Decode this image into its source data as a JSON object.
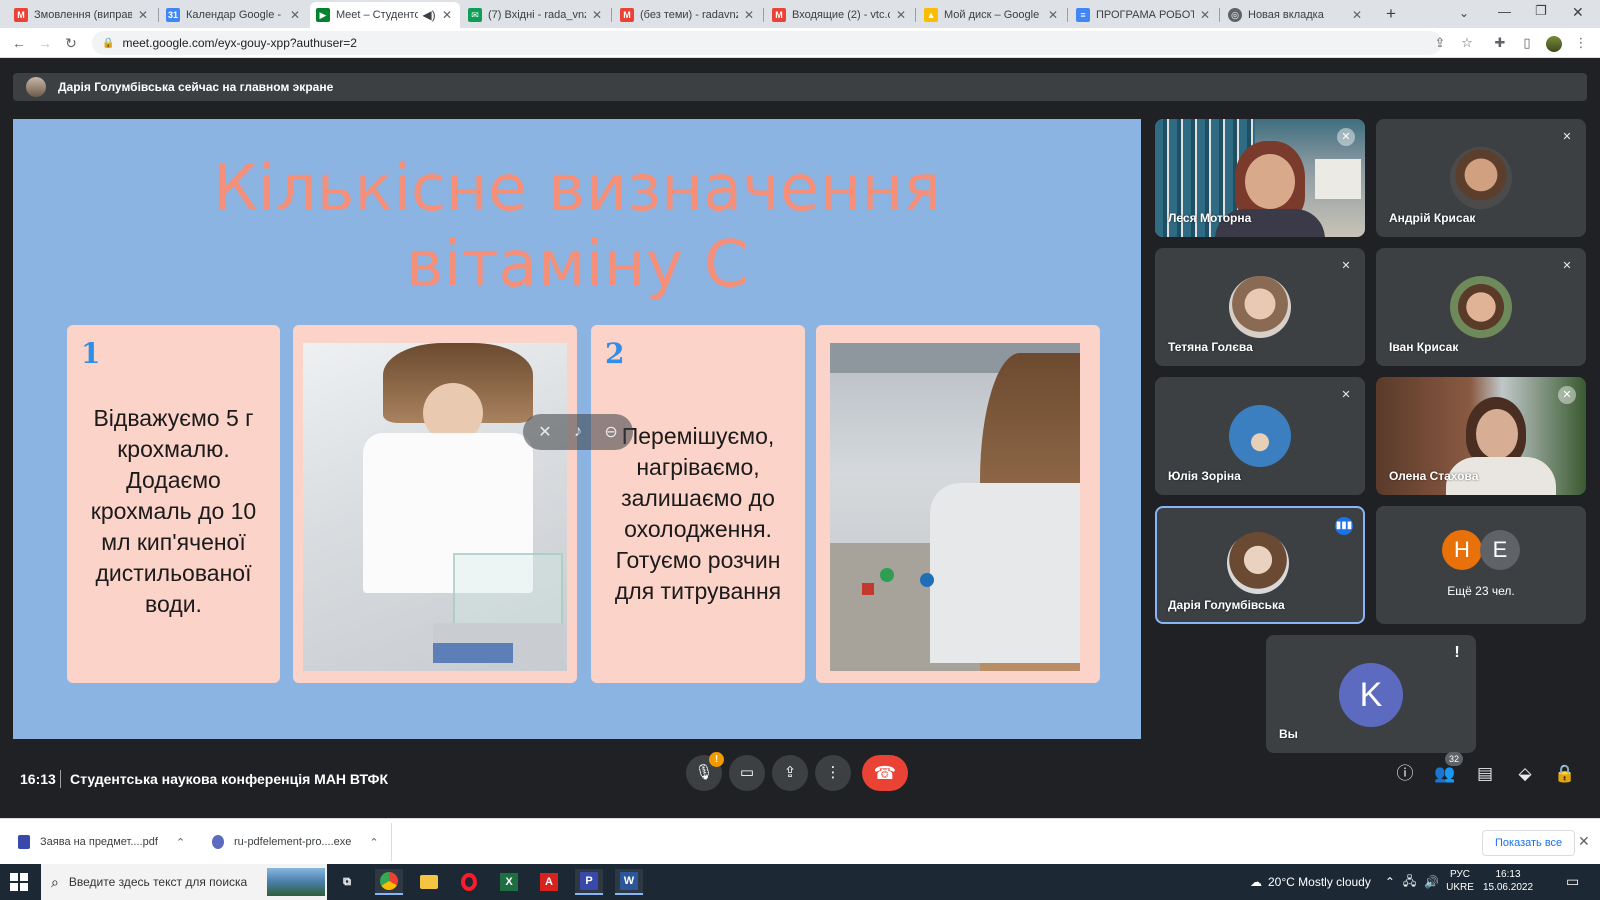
{
  "browser": {
    "tabs": [
      {
        "title": "Змовлення (виправле",
        "icon": "gmail-icon",
        "color": "#ea4335"
      },
      {
        "title": "Календар Google - Де",
        "icon": "calendar-icon",
        "color": "#4285f4"
      },
      {
        "title": "Meet – Студентсь",
        "icon": "meet-icon",
        "color": "#00832d",
        "audio_icon": "speaker-icon",
        "active": true
      },
      {
        "title": "(7) Вхідні - rada_vnz@",
        "icon": "mail-icon",
        "color": "#0f9d58"
      },
      {
        "title": "(без теми) - radavnzv",
        "icon": "gmail-icon",
        "color": "#ea4335"
      },
      {
        "title": "Входящие (2) - vtc.co",
        "icon": "gmail-icon",
        "color": "#ea4335"
      },
      {
        "title": "Мой диск – Google Д",
        "icon": "drive-icon",
        "color": "#fbbc04"
      },
      {
        "title": "ПРОГРАМА РОБОТИ",
        "icon": "docs-icon",
        "color": "#4285f4"
      },
      {
        "title": "Новая вкладка",
        "icon": "chrome-icon",
        "color": "#5f6368"
      }
    ],
    "new_tab": "+",
    "url": "meet.google.com/eyx-gouy-xpp?authuser=2"
  },
  "meet": {
    "presenter_banner": "Дарія Голумбівська сейчас на главном экране",
    "slide": {
      "title_line1": "Кількісне визначення",
      "title_line2": "вітаміну С",
      "step1_number": "1",
      "step1_text": "Відважуємо 5 г крохмалю. Додаємо крохмаль до 10 мл кип'яченої дистильованої води.",
      "step2_number": "2",
      "step2_text": "Перемішуємо, нагріваємо, залишаємо до охолодження. Готуємо розчин для титрування"
    },
    "participants": [
      {
        "name": "Леся Моторна",
        "video": true,
        "muted": true
      },
      {
        "name": "Андрій Крисак",
        "video": false,
        "muted": true
      },
      {
        "name": "Тетяна Голєва",
        "video": false,
        "muted": true
      },
      {
        "name": "Іван Крисак",
        "video": false,
        "muted": true
      },
      {
        "name": "Юлія Зоріна",
        "video": false,
        "muted": true
      },
      {
        "name": "Олена Стахова",
        "video": true,
        "muted": true
      },
      {
        "name": "Дарія Голумбівська",
        "video": false,
        "speaking": true
      }
    ],
    "more": {
      "avatars": [
        "H",
        "E"
      ],
      "avatar_colors": [
        "#e8710a",
        "#5f6368"
      ],
      "label": "Ещё 23 чел."
    },
    "self_tile": {
      "letter": "K",
      "label": "Вы",
      "avatar_color": "#5c6bc0"
    },
    "time": "16:13",
    "meeting_title": "Студентська наукова конференція МАН ВТФК",
    "participants_count": "32",
    "mic_warning": "!"
  },
  "downloads": {
    "items": [
      {
        "name": "Заява на предмет....pdf"
      },
      {
        "name": "ru-pdfelement-pro....exe"
      }
    ],
    "show_all": "Показать все"
  },
  "taskbar": {
    "search_placeholder": "Введите здесь текст для поиска",
    "weather": "20°C  Mostly cloudy",
    "lang_line1": "РУС",
    "lang_line2": "UKRE",
    "time": "16:13",
    "date": "15.06.2022"
  }
}
